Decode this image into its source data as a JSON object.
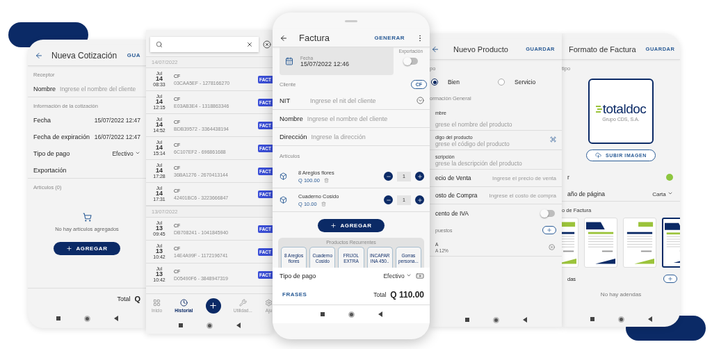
{
  "quote_screen": {
    "title": "Nueva Cotización",
    "action": "GUA",
    "receiver_section": "Receptor",
    "name_label": "Nombre",
    "name_placeholder": "Ingrese el nombre del cliente",
    "info_section": "Información de la cotización",
    "rows": [
      {
        "kind": "value",
        "label": "Fecha",
        "value": "15/07/2022 12:47"
      },
      {
        "kind": "value",
        "label": "Fecha de expiración",
        "value": "16/07/2022 12:47"
      },
      {
        "kind": "dropdown",
        "label": "Tipo de pago",
        "value": "Efectivo"
      },
      {
        "kind": "plain",
        "label": "Exportación"
      }
    ],
    "items_section": "Artículos (0)",
    "empty_text": "No hay artículos agregados",
    "add_button": "AGREGAR",
    "total_label": "Total",
    "total_value": "Q"
  },
  "history_screen": {
    "groups": [
      {
        "date": "14/07/2022",
        "entries": [
          {
            "month": "Jul",
            "day": "14",
            "time": "08:33",
            "title": "CF",
            "code": "03CAA5EF - 1278166270",
            "tag": "FACT"
          },
          {
            "month": "Jul",
            "day": "14",
            "time": "12:15",
            "title": "CF",
            "code": "E03AB3E4 - 1318863346",
            "tag": "FACT"
          },
          {
            "month": "Jul",
            "day": "14",
            "time": "14:52",
            "title": "CF",
            "code": "BDB39572 - 3364438194",
            "tag": "FACT"
          },
          {
            "month": "Jul",
            "day": "14",
            "time": "15:14",
            "title": "CF",
            "code": "6C107EF2 - 696861688",
            "tag": "FACT"
          },
          {
            "month": "Jul",
            "day": "14",
            "time": "17:28",
            "title": "CF",
            "code": "36BA1276 - 2670413144",
            "tag": "FACT"
          },
          {
            "month": "Jul",
            "day": "14",
            "time": "17:31",
            "title": "CF",
            "code": "42401BC6 - 3223666847",
            "tag": "FACT"
          }
        ]
      },
      {
        "date": "13/07/2022",
        "entries": [
          {
            "month": "Jul",
            "day": "13",
            "time": "09:45",
            "title": "CF",
            "code": "DB708241 - 1041845940",
            "tag": "FACT"
          },
          {
            "month": "Jul",
            "day": "13",
            "time": "10:42",
            "title": "CF",
            "code": "14E4A99F - 1172196741",
            "tag": "FACT"
          },
          {
            "month": "Jul",
            "day": "13",
            "time": "10:42",
            "title": "CF",
            "code": "D05490F6 - 3848947319",
            "tag": "FACT"
          }
        ]
      }
    ],
    "nav": [
      {
        "kind": "grid",
        "label": "Inicio",
        "selected": false
      },
      {
        "kind": "clock",
        "label": "Historial",
        "selected": true
      },
      {
        "kind": "add"
      },
      {
        "kind": "tools",
        "label": "Utilidad...",
        "selected": false
      },
      {
        "kind": "gear",
        "label": "Aju",
        "selected": false
      }
    ]
  },
  "invoice_screen": {
    "title": "Factura",
    "action": "GENERAR",
    "date_label": "Fecha",
    "date": "15/07/2022 12:46",
    "export_label": "Exportación",
    "export_on": false,
    "client_section": "Cliente",
    "client_chip": "CF",
    "fields": [
      {
        "kind": "dropdown",
        "label": "NIT",
        "placeholder": "Ingrese el nit del cliente"
      },
      {
        "kind": "text",
        "label": "Nombre",
        "placeholder": "Ingrese el nombre del cliente"
      },
      {
        "kind": "text",
        "label": "Dirección",
        "placeholder": "Ingrese la dirección"
      }
    ],
    "items_section": "Artículos",
    "items": [
      {
        "name": "8 Areglos flores",
        "price": "Q 100.00",
        "qty": "1"
      },
      {
        "name": "Cuaderno Cosido",
        "price": "Q 10.00",
        "qty": "1"
      }
    ],
    "add_button": "AGREGAR",
    "recurring_title": "Productos Recurrentes",
    "recurring": [
      "8 Areglos flores",
      "Cuaderno Cosido",
      "FRIJOL EXTRA",
      "INCAPAR INA 450..",
      "Gorras persona..."
    ],
    "payment_label": "Tipo de pago",
    "payment_value": "Efectivo",
    "phrases_button": "FRASES",
    "total_label": "Total",
    "total_value": "Q 110.00"
  },
  "product_screen": {
    "title": "Nuevo Producto",
    "action": "GUARDAR",
    "type_section": "po",
    "types": [
      {
        "label": "Bien",
        "selected": true
      },
      {
        "label": "Servicio",
        "selected": false
      }
    ],
    "general_section": "ormación General",
    "fields": [
      {
        "kind": "stacked",
        "label": "mbre",
        "placeholder": "grese el nombre del producto"
      },
      {
        "kind": "scan",
        "label": "digo del producto",
        "placeholder": "grese el código del producto"
      },
      {
        "kind": "stacked",
        "label": "scripción",
        "placeholder": "grese la descripción del producto"
      },
      {
        "kind": "inline",
        "label": "ecio de Venta",
        "placeholder": "Ingrese el precio de venta"
      },
      {
        "kind": "inline",
        "label": "osto de Compra",
        "placeholder": "Ingrese el costo de compra"
      },
      {
        "kind": "toggle",
        "label": "cento de IVA",
        "on": false
      }
    ],
    "taxes_section": "puestos",
    "taxes": [
      {
        "name": "A",
        "detail": "A 12%"
      }
    ]
  },
  "format_screen": {
    "title": "Formato de Factura",
    "action": "GUARDAR",
    "logo_section": "tipo",
    "logo_name": "totaldoc",
    "logo_caption": "Grupo CDS, S.A.",
    "upload_button": "SUBIR IMAGEN",
    "color_label": "r",
    "color": "#8dc63f",
    "page_size_label": "año de página",
    "page_size_value": "Carta",
    "templates_section": "o de Factura",
    "templates": [
      {
        "selected": false
      },
      {
        "selected": false
      },
      {
        "selected": false
      },
      {
        "selected": true
      }
    ],
    "addenda_section": "das",
    "empty_text": "No hay adendas"
  }
}
